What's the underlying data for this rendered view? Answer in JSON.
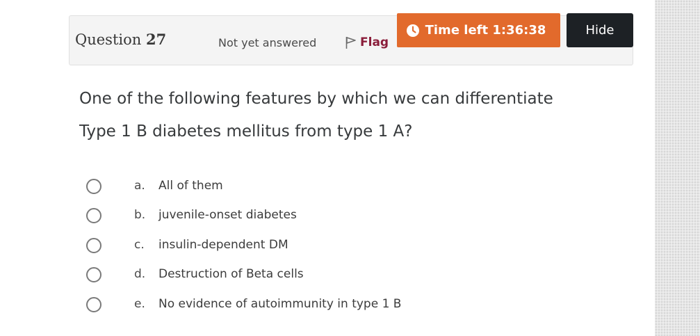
{
  "question_info": {
    "label": "Question",
    "number": "27",
    "status": "Not yet answered",
    "flag_label": "Flag",
    "flag_icon": "flag-icon"
  },
  "timer": {
    "label": "Time left 1:36:38",
    "icon": "clock-icon",
    "color": "#e26a2c"
  },
  "hide_button": {
    "label": "Hide"
  },
  "question": {
    "lines": [
      "One of the following features by which we can differentiate",
      "Type 1 B diabetes mellitus from type 1 A?"
    ]
  },
  "answers": [
    {
      "letter": "a.",
      "text": "All of them",
      "selected": false
    },
    {
      "letter": "b.",
      "text": "juvenile-onset diabetes",
      "selected": false
    },
    {
      "letter": "c.",
      "text": "insulin-dependent DM",
      "selected": false
    },
    {
      "letter": "d.",
      "text": "Destruction of Beta cells",
      "selected": false
    },
    {
      "letter": "e.",
      "text": "No evidence of autoimmunity in type 1 B",
      "selected": false
    }
  ]
}
